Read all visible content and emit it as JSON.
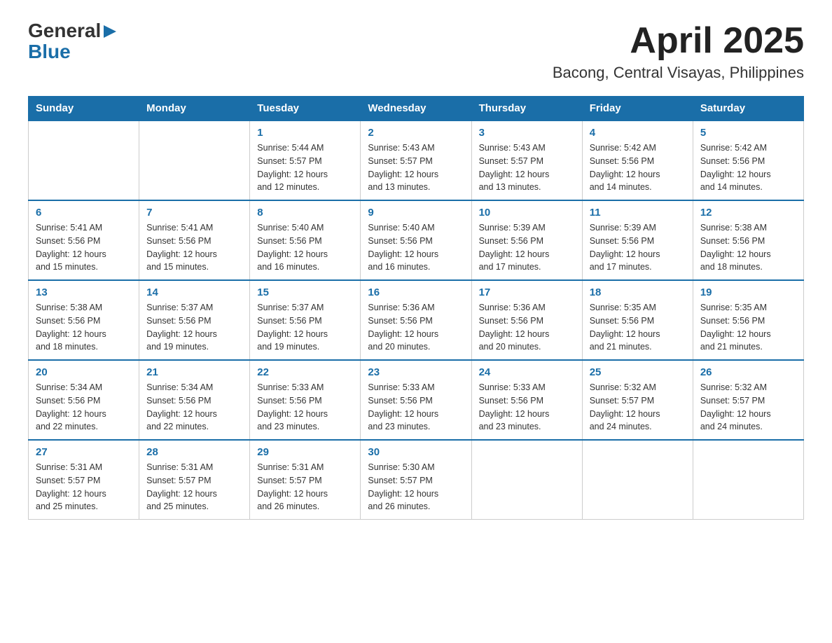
{
  "logo": {
    "general": "General",
    "blue": "Blue",
    "arrow": "▶"
  },
  "header": {
    "month": "April 2025",
    "location": "Bacong, Central Visayas, Philippines"
  },
  "weekdays": [
    "Sunday",
    "Monday",
    "Tuesday",
    "Wednesday",
    "Thursday",
    "Friday",
    "Saturday"
  ],
  "weeks": [
    [
      {
        "day": "",
        "info": ""
      },
      {
        "day": "",
        "info": ""
      },
      {
        "day": "1",
        "info": "Sunrise: 5:44 AM\nSunset: 5:57 PM\nDaylight: 12 hours\nand 12 minutes."
      },
      {
        "day": "2",
        "info": "Sunrise: 5:43 AM\nSunset: 5:57 PM\nDaylight: 12 hours\nand 13 minutes."
      },
      {
        "day": "3",
        "info": "Sunrise: 5:43 AM\nSunset: 5:57 PM\nDaylight: 12 hours\nand 13 minutes."
      },
      {
        "day": "4",
        "info": "Sunrise: 5:42 AM\nSunset: 5:56 PM\nDaylight: 12 hours\nand 14 minutes."
      },
      {
        "day": "5",
        "info": "Sunrise: 5:42 AM\nSunset: 5:56 PM\nDaylight: 12 hours\nand 14 minutes."
      }
    ],
    [
      {
        "day": "6",
        "info": "Sunrise: 5:41 AM\nSunset: 5:56 PM\nDaylight: 12 hours\nand 15 minutes."
      },
      {
        "day": "7",
        "info": "Sunrise: 5:41 AM\nSunset: 5:56 PM\nDaylight: 12 hours\nand 15 minutes."
      },
      {
        "day": "8",
        "info": "Sunrise: 5:40 AM\nSunset: 5:56 PM\nDaylight: 12 hours\nand 16 minutes."
      },
      {
        "day": "9",
        "info": "Sunrise: 5:40 AM\nSunset: 5:56 PM\nDaylight: 12 hours\nand 16 minutes."
      },
      {
        "day": "10",
        "info": "Sunrise: 5:39 AM\nSunset: 5:56 PM\nDaylight: 12 hours\nand 17 minutes."
      },
      {
        "day": "11",
        "info": "Sunrise: 5:39 AM\nSunset: 5:56 PM\nDaylight: 12 hours\nand 17 minutes."
      },
      {
        "day": "12",
        "info": "Sunrise: 5:38 AM\nSunset: 5:56 PM\nDaylight: 12 hours\nand 18 minutes."
      }
    ],
    [
      {
        "day": "13",
        "info": "Sunrise: 5:38 AM\nSunset: 5:56 PM\nDaylight: 12 hours\nand 18 minutes."
      },
      {
        "day": "14",
        "info": "Sunrise: 5:37 AM\nSunset: 5:56 PM\nDaylight: 12 hours\nand 19 minutes."
      },
      {
        "day": "15",
        "info": "Sunrise: 5:37 AM\nSunset: 5:56 PM\nDaylight: 12 hours\nand 19 minutes."
      },
      {
        "day": "16",
        "info": "Sunrise: 5:36 AM\nSunset: 5:56 PM\nDaylight: 12 hours\nand 20 minutes."
      },
      {
        "day": "17",
        "info": "Sunrise: 5:36 AM\nSunset: 5:56 PM\nDaylight: 12 hours\nand 20 minutes."
      },
      {
        "day": "18",
        "info": "Sunrise: 5:35 AM\nSunset: 5:56 PM\nDaylight: 12 hours\nand 21 minutes."
      },
      {
        "day": "19",
        "info": "Sunrise: 5:35 AM\nSunset: 5:56 PM\nDaylight: 12 hours\nand 21 minutes."
      }
    ],
    [
      {
        "day": "20",
        "info": "Sunrise: 5:34 AM\nSunset: 5:56 PM\nDaylight: 12 hours\nand 22 minutes."
      },
      {
        "day": "21",
        "info": "Sunrise: 5:34 AM\nSunset: 5:56 PM\nDaylight: 12 hours\nand 22 minutes."
      },
      {
        "day": "22",
        "info": "Sunrise: 5:33 AM\nSunset: 5:56 PM\nDaylight: 12 hours\nand 23 minutes."
      },
      {
        "day": "23",
        "info": "Sunrise: 5:33 AM\nSunset: 5:56 PM\nDaylight: 12 hours\nand 23 minutes."
      },
      {
        "day": "24",
        "info": "Sunrise: 5:33 AM\nSunset: 5:56 PM\nDaylight: 12 hours\nand 23 minutes."
      },
      {
        "day": "25",
        "info": "Sunrise: 5:32 AM\nSunset: 5:57 PM\nDaylight: 12 hours\nand 24 minutes."
      },
      {
        "day": "26",
        "info": "Sunrise: 5:32 AM\nSunset: 5:57 PM\nDaylight: 12 hours\nand 24 minutes."
      }
    ],
    [
      {
        "day": "27",
        "info": "Sunrise: 5:31 AM\nSunset: 5:57 PM\nDaylight: 12 hours\nand 25 minutes."
      },
      {
        "day": "28",
        "info": "Sunrise: 5:31 AM\nSunset: 5:57 PM\nDaylight: 12 hours\nand 25 minutes."
      },
      {
        "day": "29",
        "info": "Sunrise: 5:31 AM\nSunset: 5:57 PM\nDaylight: 12 hours\nand 26 minutes."
      },
      {
        "day": "30",
        "info": "Sunrise: 5:30 AM\nSunset: 5:57 PM\nDaylight: 12 hours\nand 26 minutes."
      },
      {
        "day": "",
        "info": ""
      },
      {
        "day": "",
        "info": ""
      },
      {
        "day": "",
        "info": ""
      }
    ]
  ]
}
